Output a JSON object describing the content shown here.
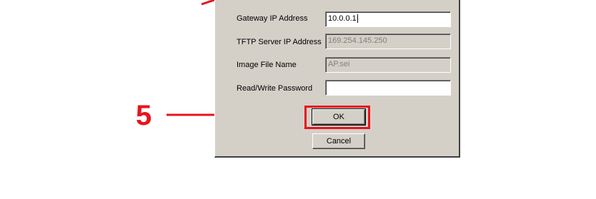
{
  "dialog": {
    "fields": [
      {
        "label": "Gateway IP Address",
        "value": "10.0.0.1",
        "enabled": true
      },
      {
        "label": "TFTP Server IP Address",
        "value": "169.254.145.250",
        "enabled": false
      },
      {
        "label": "Image File Name",
        "value": "AP.sei",
        "enabled": false
      },
      {
        "label": "Read/Write Password",
        "value": "",
        "enabled": true
      }
    ],
    "ok_label": "OK",
    "cancel_label": "Cancel"
  },
  "annotation": {
    "step_number": "5",
    "color": "#e8141c"
  }
}
